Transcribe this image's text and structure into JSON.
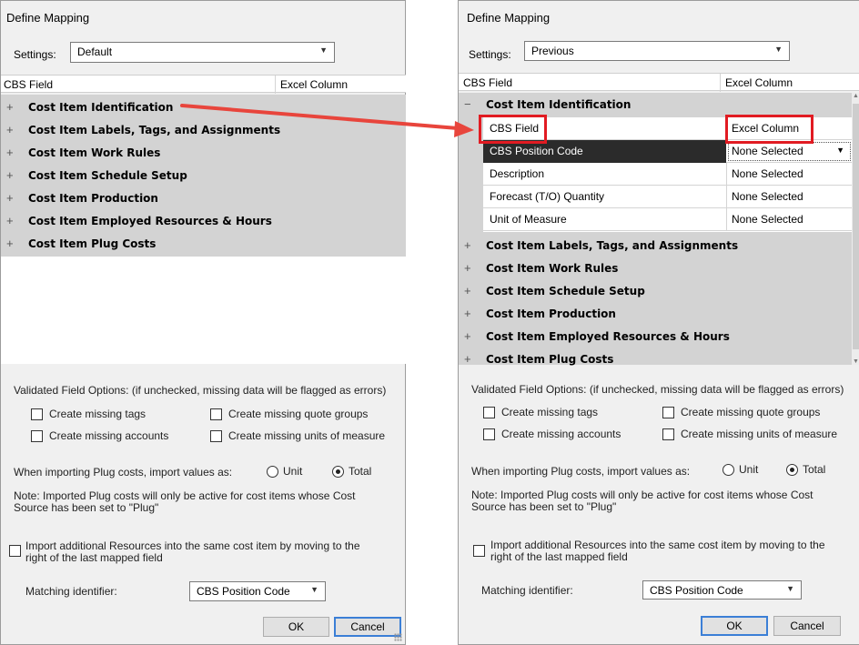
{
  "left": {
    "title": "Define Mapping",
    "settings_label": "Settings:",
    "settings_value": "Default",
    "col_cbs": "CBS Field",
    "col_excel": "Excel Column",
    "groups": [
      {
        "sign": "+",
        "label": "Cost Item Identification"
      },
      {
        "sign": "+",
        "label": "Cost Item Labels, Tags, and Assignments"
      },
      {
        "sign": "+",
        "label": "Cost Item Work Rules"
      },
      {
        "sign": "+",
        "label": "Cost Item Schedule Setup"
      },
      {
        "sign": "+",
        "label": "Cost Item Production"
      },
      {
        "sign": "+",
        "label": "Cost Item Employed Resources & Hours"
      },
      {
        "sign": "+",
        "label": "Cost Item Plug Costs"
      }
    ],
    "validated_text": "Validated Field Options:  (if unchecked, missing data will be flagged as errors)",
    "cb_tags": "Create missing tags",
    "cb_quote": "Create missing quote groups",
    "cb_accounts": "Create missing accounts",
    "cb_units": "Create missing units of measure",
    "plug_text": "When importing Plug costs, import values as:",
    "radio_unit": "Unit",
    "radio_total": "Total",
    "note_line1": "Note: Imported Plug costs will only be active for cost items whose Cost",
    "note_line2": "Source has been set to \"Plug\"",
    "import_line1": "Import additional Resources into the same cost item by moving to the",
    "import_line2": "right of the last mapped field",
    "matching_label": "Matching identifier:",
    "matching_value": "CBS Position Code",
    "ok": "OK",
    "cancel": "Cancel"
  },
  "right": {
    "title": "Define Mapping",
    "settings_label": "Settings:",
    "settings_value": "Previous",
    "col_cbs": "CBS Field",
    "col_excel": "Excel Column",
    "expanded_group": {
      "sign": "−",
      "label": "Cost Item Identification"
    },
    "sub_header": {
      "field": "CBS Field",
      "column": "Excel Column"
    },
    "sub_rows": [
      {
        "field": "CBS Position Code",
        "column": "None Selected"
      },
      {
        "field": "Description",
        "column": "None Selected"
      },
      {
        "field": "Forecast (T/O) Quantity",
        "column": "None Selected"
      },
      {
        "field": "Unit of Measure",
        "column": "None Selected"
      }
    ],
    "groups": [
      {
        "sign": "+",
        "label": "Cost Item Labels, Tags, and Assignments"
      },
      {
        "sign": "+",
        "label": "Cost Item Work Rules"
      },
      {
        "sign": "+",
        "label": "Cost Item Schedule Setup"
      },
      {
        "sign": "+",
        "label": "Cost Item Production"
      },
      {
        "sign": "+",
        "label": "Cost Item Employed Resources & Hours"
      },
      {
        "sign": "+",
        "label": "Cost Item Plug Costs"
      }
    ],
    "validated_text": "Validated Field Options:  (if unchecked, missing data will be flagged as errors)",
    "cb_tags": "Create missing tags",
    "cb_quote": "Create missing quote groups",
    "cb_accounts": "Create missing accounts",
    "cb_units": "Create missing units of measure",
    "plug_text": "When importing Plug costs, import values as:",
    "radio_unit": "Unit",
    "radio_total": "Total",
    "note_line1": "Note: Imported Plug costs will only be active for cost items whose Cost",
    "note_line2": "Source has been set to \"Plug\"",
    "import_line1": "Import additional Resources into the same cost item by moving to the",
    "import_line2": "right of the last mapped field",
    "matching_label": "Matching identifier:",
    "matching_value": "CBS Position Code",
    "ok": "OK",
    "cancel": "Cancel"
  },
  "colors": {
    "highlight": "#e11b22",
    "grid_bg": "#d3d3d3",
    "selected_row": "#2b2b2b",
    "dialog_bg": "#f0f0f0"
  }
}
